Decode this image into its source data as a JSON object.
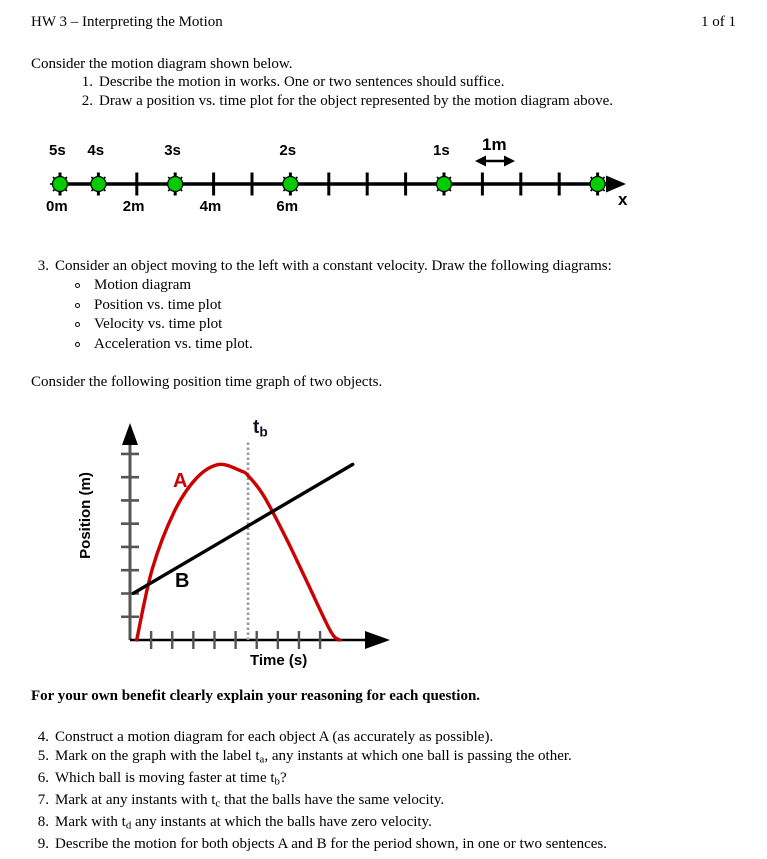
{
  "header": {
    "title": "HW 3 – Interpreting the Motion",
    "page_indicator": "1 of 1"
  },
  "intro": {
    "line": "Consider the motion diagram shown below."
  },
  "top_questions": [
    {
      "number": "1.",
      "text": "Describe the motion in works.  One or two sentences should suffice."
    },
    {
      "number": "2.",
      "text": "Draw a position vs. time plot for the object represented by the motion diagram above."
    }
  ],
  "motion_diagram": {
    "axis_label": "x",
    "scale_label": "1m",
    "time_labels": [
      "5s",
      "4s",
      "3s",
      "2s",
      "1s"
    ],
    "distance_labels": [
      "0m",
      "2m",
      "4m",
      "6m"
    ],
    "tick_count": 15,
    "dot_tick_indices": [
      0,
      1,
      3,
      6,
      10,
      14
    ],
    "dot_color": "#00cc00",
    "axis_color": "#000000"
  },
  "question3": {
    "number": "3.",
    "text": "Consider an object moving to the left with a constant velocity.  Draw the following diagrams:",
    "bullets": [
      "Motion diagram",
      "Position vs. time plot",
      "Velocity vs. time plot",
      "Acceleration vs. time plot."
    ]
  },
  "graph_intro": {
    "line": "Consider the following position time graph of two objects."
  },
  "chart_data": {
    "type": "line",
    "title": "",
    "xlabel": "Time (s)",
    "ylabel": "Position (m)",
    "xlim": [
      0,
      11
    ],
    "ylim": [
      0,
      9
    ],
    "grid": false,
    "legend": "inline-curve-labels",
    "x_tick_count": 9,
    "y_tick_count": 8,
    "annotations": [
      {
        "label": "t",
        "sub": "b",
        "type": "vertical-dotted-line",
        "x": 5.3,
        "color": "#999999"
      }
    ],
    "series": [
      {
        "name": "A",
        "label": "A",
        "color": "#cc0000",
        "shape": "parabola",
        "description": "Object A rises, peaks and falls back to zero",
        "x": [
          0.3,
          1.0,
          2.0,
          3.0,
          4.0,
          5.0,
          5.3,
          6.0,
          7.0,
          8.0,
          9.0,
          9.4
        ],
        "y": [
          0.0,
          3.2,
          5.8,
          7.3,
          7.9,
          7.6,
          7.4,
          6.5,
          4.6,
          2.5,
          0.4,
          0.0
        ]
      },
      {
        "name": "B",
        "label": "B",
        "color": "#000000",
        "shape": "straight-line",
        "description": "Object B moves with constant positive velocity",
        "x": [
          0.15,
          10.0
        ],
        "y": [
          2.1,
          7.9
        ]
      }
    ]
  },
  "benefit_note": {
    "text": "For your own benefit clearly explain your reasoning for each question."
  },
  "bottom_questions": [
    {
      "number": "4.",
      "parts": [
        {
          "t": "Construct a motion diagram for each object A (as accurately as possible)."
        }
      ]
    },
    {
      "number": "5.",
      "parts": [
        {
          "t": "Mark on the graph with the label t"
        },
        {
          "sub": "a"
        },
        {
          "t": ", any instants at which one ball is passing the other."
        }
      ]
    },
    {
      "number": "6.",
      "parts": [
        {
          "t": "Which ball is moving faster at time t"
        },
        {
          "sub": "b"
        },
        {
          "t": "?"
        }
      ]
    },
    {
      "number": "7.",
      "parts": [
        {
          "t": "Mark at any instants with t"
        },
        {
          "sub": "c"
        },
        {
          "t": " that the balls have the same velocity."
        }
      ]
    },
    {
      "number": "8.",
      "parts": [
        {
          "t": "Mark with t"
        },
        {
          "sub": "d"
        },
        {
          "t": " any instants at which the balls have zero velocity."
        }
      ]
    },
    {
      "number": "9.",
      "parts": [
        {
          "t": "Describe the motion for both objects A and B for the period shown, in one or two sentences."
        }
      ]
    }
  ]
}
